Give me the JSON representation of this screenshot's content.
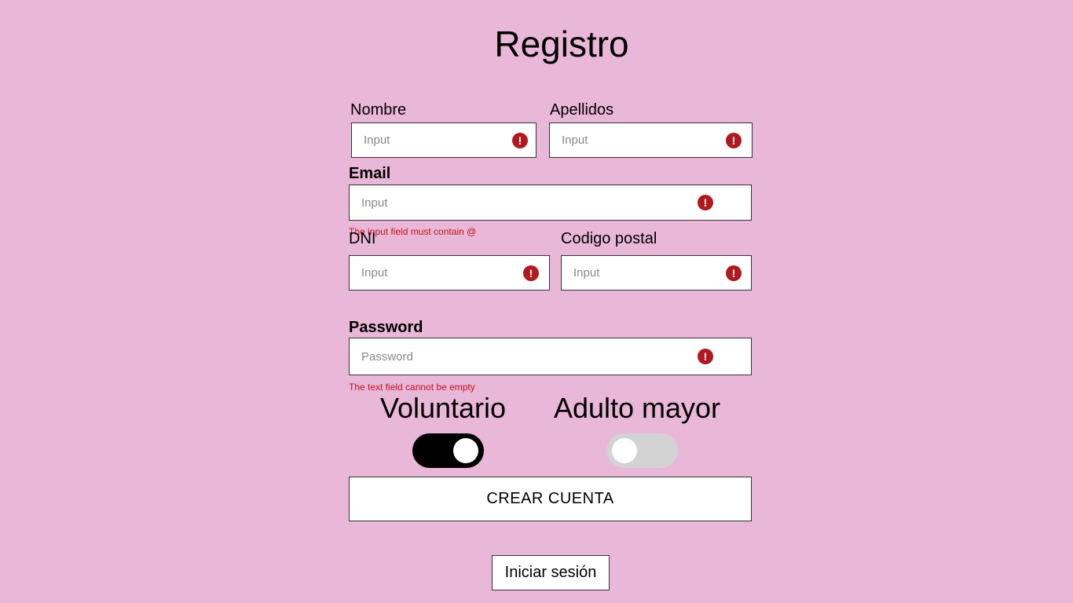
{
  "page": {
    "title": "Registro"
  },
  "form": {
    "nombre": {
      "label": "Nombre",
      "placeholder": "Input",
      "value": ""
    },
    "apellidos": {
      "label": "Apellidos",
      "placeholder": "Input",
      "value": ""
    },
    "email": {
      "label": "Email",
      "placeholder": "Input",
      "value": "",
      "error": "The input field must contain @"
    },
    "dni": {
      "label": "DNI",
      "placeholder": "Input",
      "value": ""
    },
    "codigo_postal": {
      "label": "Codigo postal",
      "placeholder": "Input",
      "value": ""
    },
    "password": {
      "label": "Password",
      "placeholder": "Password",
      "value": "",
      "error": "The text field cannot be empty"
    },
    "error_icon": "exclamation-circle-icon",
    "error_color": "#b0191e"
  },
  "toggles": {
    "voluntario": {
      "label": "Voluntario",
      "on": true
    },
    "adulto_mayor": {
      "label": "Adulto mayor",
      "on": false
    }
  },
  "buttons": {
    "create": "CREAR CUENTA",
    "login": "Iniciar sesión"
  },
  "colors": {
    "background": "#e9b7d7",
    "toggle_on": "#000000",
    "toggle_off": "#d3d3d3"
  }
}
